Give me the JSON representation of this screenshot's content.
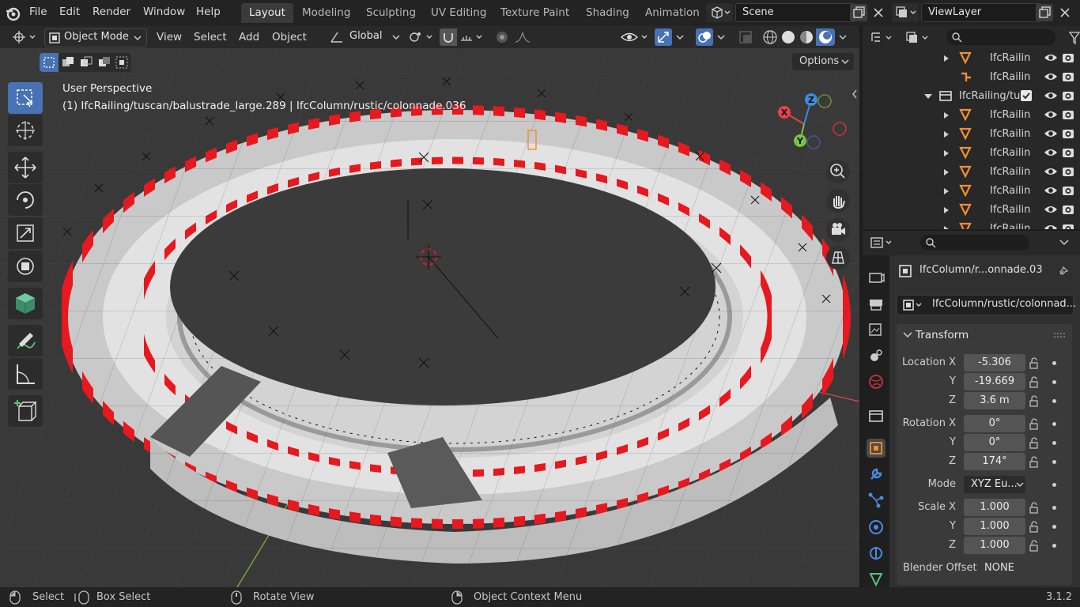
{
  "menu": {
    "file": "File",
    "edit": "Edit",
    "render": "Render",
    "window": "Window",
    "help": "Help"
  },
  "workspaces": [
    "Layout",
    "Modeling",
    "Sculpting",
    "UV Editing",
    "Texture Paint",
    "Shading",
    "Animation"
  ],
  "scene": {
    "name": "Scene"
  },
  "view_layer": {
    "name": "ViewLayer"
  },
  "viewport_header": {
    "mode": "Object Mode",
    "view": "View",
    "select": "Select",
    "add": "Add",
    "object": "Object",
    "orientation": "Global",
    "options": "Options"
  },
  "viewport": {
    "perspective": "User Perspective",
    "active_info": "(1) IfcRailing/tuscan/balustrade_large.289 | IfcColumn/rustic/colonnade.036"
  },
  "gizmo": {
    "x": "X",
    "y": "Y",
    "z": "Z"
  },
  "outliner": {
    "rows": [
      {
        "label": "IfcRailin"
      },
      {
        "label": "IfcRailin"
      },
      {
        "label": "IfcRailing/tu"
      },
      {
        "label": "IfcRailin"
      },
      {
        "label": "IfcRailin"
      },
      {
        "label": "IfcRailin"
      },
      {
        "label": "IfcRailin"
      },
      {
        "label": "IfcRailin"
      },
      {
        "label": "IfcRailin"
      },
      {
        "label": "IfcRailin"
      }
    ]
  },
  "properties": {
    "object_name": "IfcColumn/r...onnade.03",
    "datablock": "IfcColumn/rustic/colonnad...",
    "panel": "Transform",
    "location": {
      "label": "Location X",
      "x": "-5.306",
      "y": "-19.669",
      "z": "3.6 m"
    },
    "rotation": {
      "label": "Rotation X",
      "x": "0°",
      "y": "0°",
      "z": "174°"
    },
    "mode": {
      "label": "Mode",
      "value": "XYZ Eu..."
    },
    "scale": {
      "label": "Scale X",
      "x": "1.000",
      "y": "1.000",
      "z": "1.000"
    },
    "axis_y": "Y",
    "axis_z": "Z",
    "blender_offset": {
      "label": "Blender Offset",
      "value": "NONE"
    }
  },
  "status": {
    "select": "Select",
    "box_select": "Box Select",
    "rotate": "Rotate View",
    "context": "Object Context Menu",
    "version": "3.1.2"
  },
  "colors": {
    "accent": "#4772b3",
    "red": "#e8181f",
    "axis_x": "#e9424a",
    "axis_y": "#7bc142",
    "axis_z": "#3d8ae0",
    "orange": "#f28f30"
  }
}
